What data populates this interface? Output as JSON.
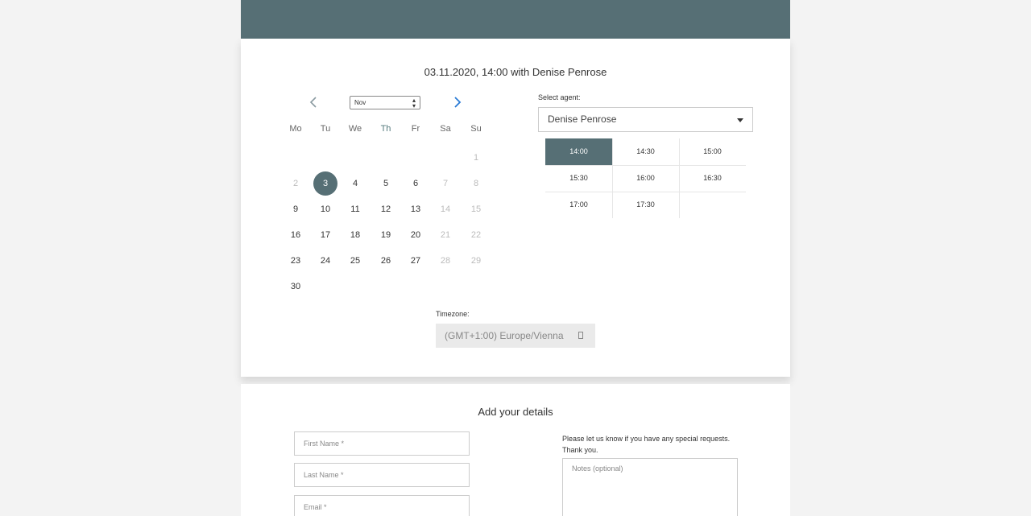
{
  "booking_summary": "03.11.2020, 14:00 with Denise Penrose",
  "calendar": {
    "month": "Nov",
    "weekdays": [
      "Mo",
      "Tu",
      "We",
      "Th",
      "Fr",
      "Sa",
      "Su"
    ],
    "weeks": [
      [
        null,
        null,
        null,
        null,
        null,
        null,
        {
          "d": "1",
          "muted": true
        }
      ],
      [
        {
          "d": "2",
          "muted": true
        },
        {
          "d": "3",
          "selected": true
        },
        {
          "d": "4"
        },
        {
          "d": "5"
        },
        {
          "d": "6"
        },
        {
          "d": "7",
          "muted": true
        },
        {
          "d": "8",
          "muted": true
        }
      ],
      [
        {
          "d": "9"
        },
        {
          "d": "10"
        },
        {
          "d": "11"
        },
        {
          "d": "12"
        },
        {
          "d": "13"
        },
        {
          "d": "14",
          "muted": true
        },
        {
          "d": "15",
          "muted": true
        }
      ],
      [
        {
          "d": "16"
        },
        {
          "d": "17"
        },
        {
          "d": "18"
        },
        {
          "d": "19"
        },
        {
          "d": "20"
        },
        {
          "d": "21",
          "muted": true
        },
        {
          "d": "22",
          "muted": true
        }
      ],
      [
        {
          "d": "23"
        },
        {
          "d": "24"
        },
        {
          "d": "25"
        },
        {
          "d": "26"
        },
        {
          "d": "27"
        },
        {
          "d": "28",
          "muted": true
        },
        {
          "d": "29",
          "muted": true
        }
      ],
      [
        {
          "d": "30"
        },
        null,
        null,
        null,
        null,
        null,
        null
      ]
    ]
  },
  "agent": {
    "label": "Select agent:",
    "value": "Denise Penrose"
  },
  "time_slots": [
    {
      "t": "14:00",
      "selected": true
    },
    {
      "t": "14:30"
    },
    {
      "t": "15:00"
    },
    {
      "t": "15:30"
    },
    {
      "t": "16:00"
    },
    {
      "t": "16:30"
    },
    {
      "t": "17:00"
    },
    {
      "t": "17:30"
    }
  ],
  "timezone": {
    "label": "Timezone:",
    "value": "(GMT+1:00) Europe/Vienna"
  },
  "details": {
    "title": "Add your details",
    "first_name_placeholder": "First Name *",
    "last_name_placeholder": "Last Name *",
    "email_placeholder": "Email *",
    "notes_prompt_line1": "Please let us know if you have any special requests.",
    "notes_prompt_line2": "Thank you.",
    "notes_placeholder": "Notes (optional)"
  },
  "colors": {
    "header": "#566f75",
    "accent": "#566f75",
    "next_arrow": "#2a7bd5"
  }
}
